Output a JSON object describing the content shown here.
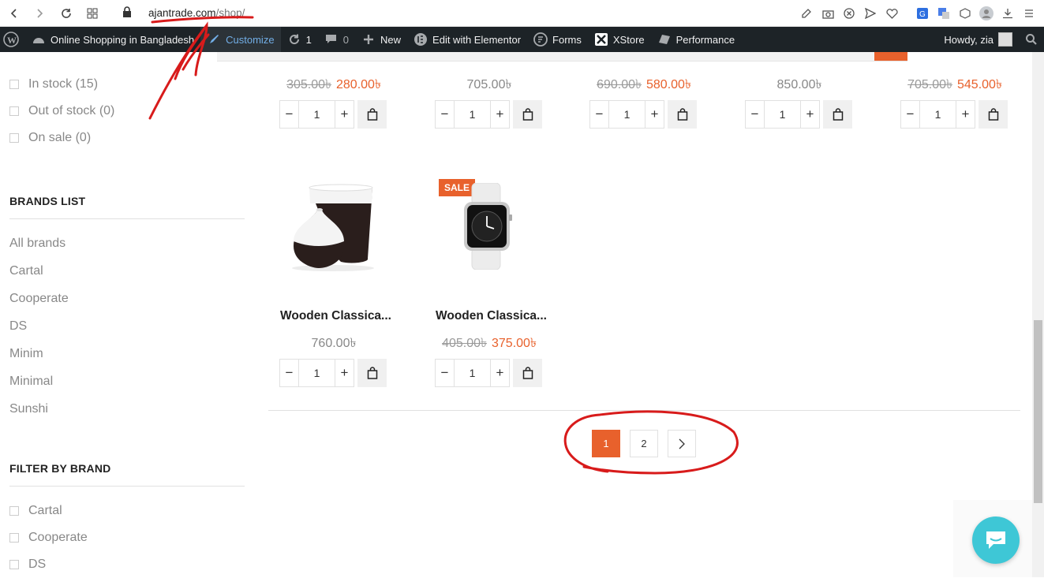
{
  "browser": {
    "url_host": "ajantrade.com",
    "url_path": "/shop/",
    "icons": [
      "back-icon",
      "forward-icon",
      "reload-icon",
      "apps-icon",
      "lock-icon",
      "edit-icon",
      "camera-icon",
      "block-icon",
      "send-icon",
      "heart-icon",
      "translate-icon",
      "google-translate-icon",
      "extension-icon",
      "profile-icon",
      "download-icon",
      "menu-icon"
    ]
  },
  "adminbar": {
    "site_name": "Online Shopping in Bangladesh",
    "customize": "Customize",
    "updates": "1",
    "comments": "0",
    "new": "New",
    "elementor": "Edit with Elementor",
    "forms": "Forms",
    "xstore": "XStore",
    "performance": "Performance",
    "howdy": "Howdy, zia"
  },
  "sidebar": {
    "stock_filters": [
      {
        "label": "In stock (15)"
      },
      {
        "label": "Out of stock (0)"
      },
      {
        "label": "On sale (0)"
      }
    ],
    "brands_list_title": "BRANDS LIST",
    "brands_list": [
      "All brands",
      "Cartal",
      "Cooperate",
      "DS",
      "Minim",
      "Minimal",
      "Sunshi"
    ],
    "filter_by_brand_title": "FILTER BY BRAND",
    "filter_by_brand": [
      "Cartal",
      "Cooperate",
      "DS"
    ]
  },
  "top_row_prices": [
    {
      "old": "305.00৳",
      "new": "280.00৳"
    },
    {
      "old": "",
      "new": "",
      "regular": "705.00৳"
    },
    {
      "old": "690.00৳",
      "new": "580.00৳"
    },
    {
      "old": "",
      "new": "",
      "regular": "850.00৳"
    },
    {
      "old": "705.00৳",
      "new": "545.00৳"
    }
  ],
  "products": [
    {
      "name": "Wooden Classica...",
      "price": "760.00৳",
      "old": "",
      "new": "",
      "qty": "1",
      "sale": ""
    },
    {
      "name": "Wooden Classica...",
      "price": "",
      "old": "405.00৳",
      "new": "375.00৳",
      "qty": "1",
      "sale": "SALE"
    }
  ],
  "qty_default": "1",
  "pagination": {
    "current": "1",
    "next_page": "2",
    "next_icon": "chevron-right-icon"
  },
  "colors": {
    "accent": "#e8612c",
    "adminbar": "#1d2327",
    "chat": "#3ec7d6",
    "annotation": "#d81b1b"
  }
}
